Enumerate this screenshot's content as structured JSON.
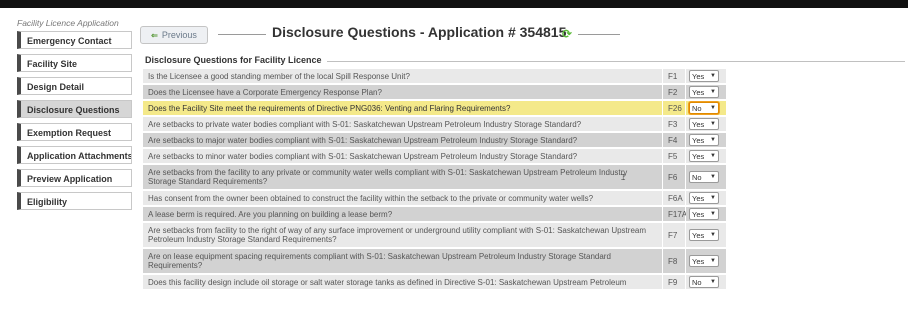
{
  "app_title": "Facility Licence Application",
  "nav": [
    {
      "label": "Emergency Contact",
      "active": false
    },
    {
      "label": "Facility Site",
      "active": false
    },
    {
      "label": "Design Detail",
      "active": false
    },
    {
      "label": "Disclosure Questions",
      "active": true
    },
    {
      "label": "Exemption Request",
      "active": false
    },
    {
      "label": "Application Attachments",
      "active": false
    },
    {
      "label": "Preview Application",
      "active": false
    },
    {
      "label": "Eligibility",
      "active": false
    }
  ],
  "header": {
    "previous_label": "Previous",
    "title": "Disclosure Questions - Application # 354815"
  },
  "section_title": "Disclosure Questions for Facility Licence",
  "questions": [
    {
      "text": "Is the Licensee a good standing member of the local Spill Response Unit?",
      "code": "F1",
      "answer": "Yes"
    },
    {
      "text": "Does the Licensee have a Corporate Emergency Response Plan?",
      "code": "F2",
      "answer": "Yes"
    },
    {
      "text": "Does the Facility Site meet the requirements of Directive PNG036: Venting and Flaring Requirements?",
      "code": "F26",
      "answer": "No"
    },
    {
      "text": "Are setbacks to private water bodies compliant with S-01: Saskatchewan Upstream Petroleum Industry Storage Standard?",
      "code": "F3",
      "answer": "Yes"
    },
    {
      "text": "Are setbacks to major water bodies compliant with S-01: Saskatchewan Upstream Petroleum Industry Storage Standard?",
      "code": "F4",
      "answer": "Yes"
    },
    {
      "text": "Are setbacks to minor water bodies compliant with S-01: Saskatchewan Upstream Petroleum Industry Storage Standard?",
      "code": "F5",
      "answer": "Yes"
    },
    {
      "text": "Are setbacks from the facility to any private or community water wells compliant with S-01: Saskatchewan Upstream Petroleum Industry Storage Standard Requirements?",
      "code": "F6",
      "answer": "No"
    },
    {
      "text": "Has consent from the owner been obtained to construct the facility within the setback to the private or community water wells?",
      "code": "F6A",
      "answer": "Yes"
    },
    {
      "text": "A lease berm is required. Are you planning on building a lease berm?",
      "code": "F17A",
      "answer": "Yes"
    },
    {
      "text": "Are setbacks from facility to the right of way of any surface improvement or underground utility compliant with S-01: Saskatchewan Upstream Petroleum Industry Storage Standard Requirements?",
      "code": "F7",
      "answer": "Yes"
    },
    {
      "text": "Are on lease equipment spacing requirements compliant with S-01: Saskatchewan Upstream Petroleum Industry Storage Standard Requirements?",
      "code": "F8",
      "answer": "Yes"
    },
    {
      "text": "Does this facility design include oil storage or salt water storage tanks as defined in Directive S-01: Saskatchewan Upstream Petroleum",
      "code": "F9",
      "answer": "No"
    }
  ],
  "highlight_color": "#f4e98a"
}
